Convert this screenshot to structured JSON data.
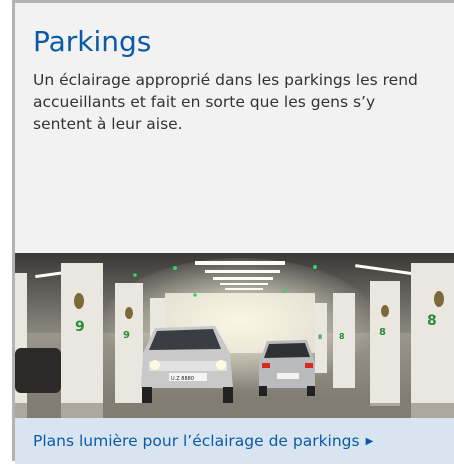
{
  "card": {
    "title": "Parkings",
    "description": "Un éclairage approprié dans les parkings les rend accueillants et fait en sorte que les gens s’y sentent à leur aise.",
    "link_label": "Plans lumière pour l’éclairage de parkings",
    "link_arrow_icon": "triangle-right-icon",
    "photo": {
      "pillar_numbers": [
        "9",
        "9",
        "9",
        "8",
        "8",
        "8",
        "8"
      ],
      "license_plate": "U.Z 8880"
    }
  },
  "colors": {
    "title": "#0b5aa8",
    "text": "#333333",
    "panel": "#f2f2f2",
    "link_bar": "#d8e5f0"
  }
}
